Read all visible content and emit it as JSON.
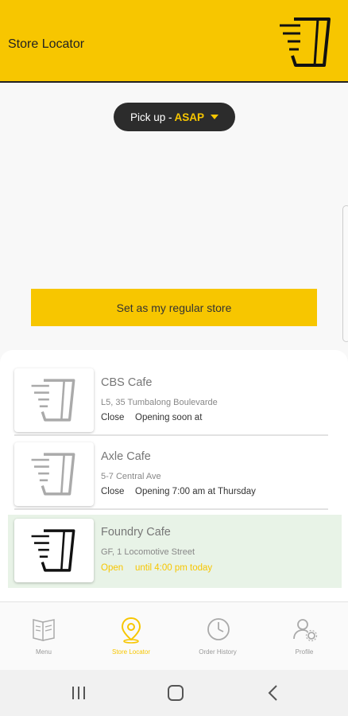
{
  "header": {
    "title": "Store Locator",
    "logo": "cup-logo-icon"
  },
  "pickup": {
    "prefix": "Pick up - ",
    "value": "ASAP",
    "icon": "caret-down-icon"
  },
  "regular_button": {
    "label": "Set as my regular store"
  },
  "stores": [
    {
      "name": "CBS Cafe",
      "address": "L5, 35 Tumbalong Boulevarde",
      "status": "Close",
      "hours": "Opening soon at",
      "selected": false
    },
    {
      "name": "Axle Cafe",
      "address": "5-7 Central Ave",
      "status": "Close",
      "hours": "Opening 7:00 am at Thursday",
      "selected": false
    },
    {
      "name": "Foundry Cafe",
      "address": "GF, 1 Locomotive Street",
      "status": "Open",
      "hours": "until 4:00 pm today",
      "selected": true
    }
  ],
  "bottom_nav": [
    {
      "label": "Menu",
      "icon": "menu-book-icon",
      "active": false
    },
    {
      "label": "Store Locator",
      "icon": "location-pin-icon",
      "active": true
    },
    {
      "label": "Order History",
      "icon": "clock-icon",
      "active": false
    },
    {
      "label": "Profile",
      "icon": "profile-gear-icon",
      "active": false
    }
  ],
  "system_nav": [
    "recent-apps-icon",
    "home-icon",
    "back-icon"
  ],
  "colors": {
    "brand_yellow": "#f7c600",
    "dark": "#2c2c2c",
    "selected_bg": "#e8f3e7"
  }
}
